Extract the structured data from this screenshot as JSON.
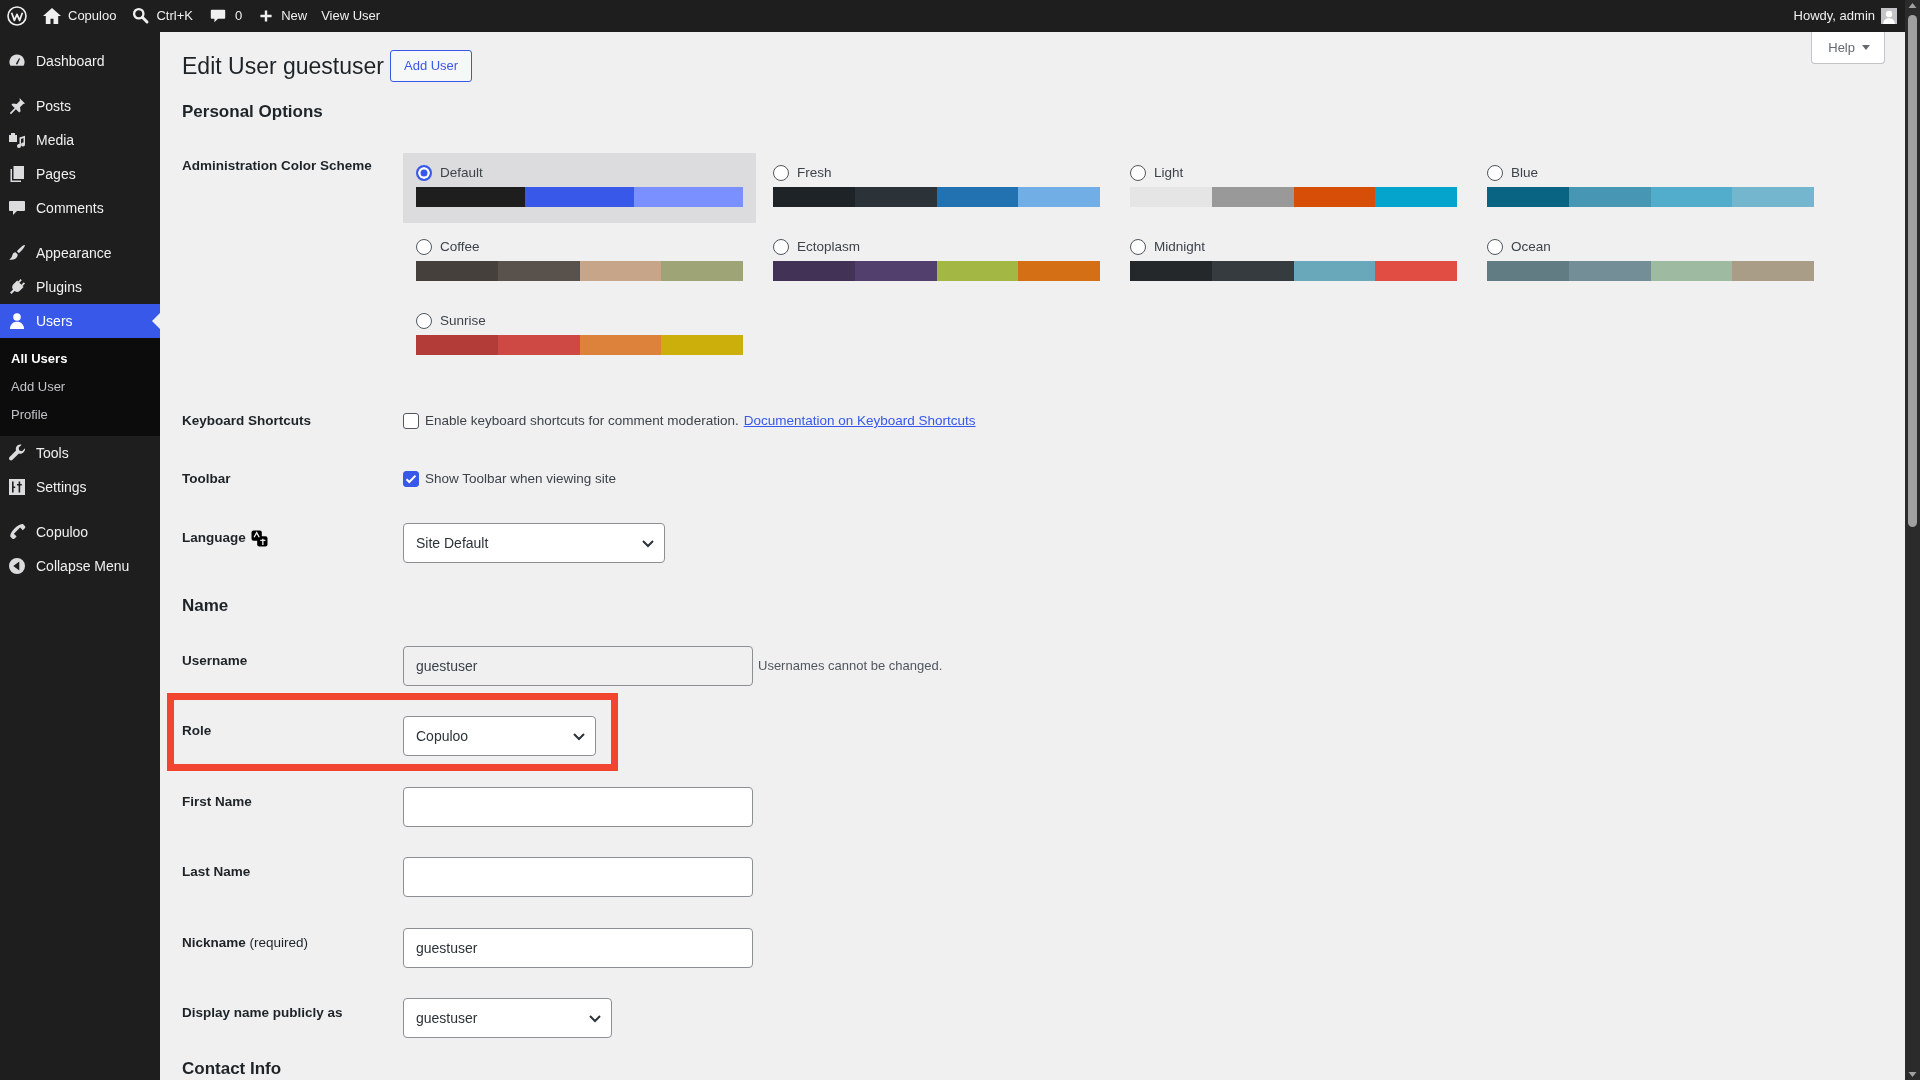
{
  "admin_bar": {
    "site_name": "Copuloo",
    "search_shortcut": "Ctrl+K",
    "comment_count": "0",
    "new_label": "New",
    "view_label": "View User",
    "greeting": "Howdy, admin"
  },
  "sidebar": {
    "sections": [
      {
        "items": [
          {
            "label": "Dashboard",
            "selected": false
          }
        ]
      },
      {
        "items": [
          {
            "label": "Posts",
            "selected": false
          },
          {
            "label": "Media",
            "selected": false
          },
          {
            "label": "Pages",
            "selected": false
          },
          {
            "label": "Comments",
            "selected": false
          }
        ]
      },
      {
        "items": [
          {
            "label": "Appearance",
            "selected": false
          },
          {
            "label": "Plugins",
            "selected": false
          },
          {
            "label": "Users",
            "selected": true,
            "children": [
              {
                "label": "All Users",
                "selected": true
              },
              {
                "label": "Add User",
                "selected": false
              },
              {
                "label": "Profile",
                "selected": false
              }
            ]
          },
          {
            "label": "Tools",
            "selected": false
          },
          {
            "label": "Settings",
            "selected": false
          }
        ]
      },
      {
        "items": [
          {
            "label": "Copuloo",
            "selected": false
          },
          {
            "label": "Collapse Menu",
            "selected": false
          }
        ]
      }
    ]
  },
  "page": {
    "title": "Edit User guestuser",
    "title_action": "Add User",
    "help": "Help"
  },
  "sections": [
    {
      "heading": "Personal Options",
      "fields": [
        {
          "kind": "color_schemes",
          "label": "Administration Color Scheme",
          "schemes": [
            {
              "name": "Default",
              "selected": true,
              "swatches": [
                {
                  "color": "#1e1e1e"
                },
                {
                  "color": "#3858e9"
                },
                {
                  "color": "#7b90ff"
                }
              ]
            },
            {
              "name": "Fresh",
              "selected": false,
              "swatches": [
                {
                  "color": "#1d2327"
                },
                {
                  "color": "#2c3338"
                },
                {
                  "color": "#2271b1"
                },
                {
                  "color": "#72aee6"
                }
              ]
            },
            {
              "name": "Light",
              "selected": false,
              "swatches": [
                {
                  "color": "#e5e5e5"
                },
                {
                  "color": "#999999"
                },
                {
                  "color": "#d64e07"
                },
                {
                  "color": "#04a4cc"
                }
              ]
            },
            {
              "name": "Blue",
              "selected": false,
              "swatches": [
                {
                  "color": "#096484"
                },
                {
                  "color": "#4796b3"
                },
                {
                  "color": "#52accc"
                },
                {
                  "color": "#74b6ce"
                }
              ]
            },
            {
              "name": "Coffee",
              "selected": false,
              "swatches": [
                {
                  "color": "#46403c"
                },
                {
                  "color": "#59524c"
                },
                {
                  "color": "#c7a589"
                },
                {
                  "color": "#9ea476"
                }
              ]
            },
            {
              "name": "Ectoplasm",
              "selected": false,
              "swatches": [
                {
                  "color": "#413256"
                },
                {
                  "color": "#523f6d"
                },
                {
                  "color": "#a3b745"
                },
                {
                  "color": "#d46f15"
                }
              ]
            },
            {
              "name": "Midnight",
              "selected": false,
              "swatches": [
                {
                  "color": "#25282b"
                },
                {
                  "color": "#363b3f"
                },
                {
                  "color": "#69a8bb"
                },
                {
                  "color": "#e14d43"
                }
              ]
            },
            {
              "name": "Ocean",
              "selected": false,
              "swatches": [
                {
                  "color": "#627c83"
                },
                {
                  "color": "#738e96"
                },
                {
                  "color": "#9ebaa0"
                },
                {
                  "color": "#aa9d88"
                }
              ]
            },
            {
              "name": "Sunrise",
              "selected": false,
              "swatches": [
                {
                  "color": "#b43c38"
                },
                {
                  "color": "#cf4944"
                },
                {
                  "color": "#dd823b"
                },
                {
                  "color": "#ccaf0b"
                }
              ]
            }
          ]
        },
        {
          "kind": "checkbox",
          "label": "Keyboard Shortcuts",
          "text": "Enable keyboard shortcuts for comment moderation.",
          "link": "Documentation on Keyboard Shortcuts",
          "checked": false
        },
        {
          "kind": "checkbox",
          "label": "Toolbar",
          "text": "Show Toolbar when viewing site",
          "checked": true
        },
        {
          "kind": "language",
          "label": "Language",
          "value": "Site Default"
        }
      ]
    },
    {
      "heading": "Name",
      "fields": [
        {
          "kind": "text",
          "label": "Username",
          "value": "guestuser",
          "disabled": true,
          "description": "Usernames cannot be changed."
        },
        {
          "kind": "select",
          "label": "Role",
          "value": "Copuloo",
          "highlighted": true
        },
        {
          "kind": "text",
          "label": "First Name"
        },
        {
          "kind": "text",
          "label": "Last Name"
        },
        {
          "kind": "text",
          "label": "Nickname",
          "label_note": "(required)",
          "value": "guestuser"
        },
        {
          "kind": "select",
          "label": "Display name publicly as",
          "value": "guestuser"
        }
      ]
    },
    {
      "heading": "Contact Info"
    }
  ]
}
